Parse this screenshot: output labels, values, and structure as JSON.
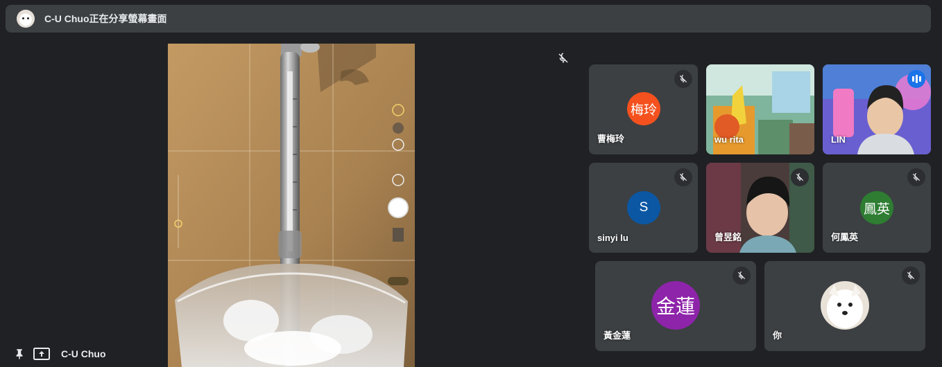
{
  "banner": {
    "text": "C-U Chuo正在分享螢幕畫面"
  },
  "presenter": {
    "name": "C-U Chuo"
  },
  "participants": [
    {
      "name": "曹梅玲",
      "initials": "梅玲",
      "avatar_color": "#f4511e",
      "muted": true
    },
    {
      "name": "wu rita",
      "video": true,
      "muted": false
    },
    {
      "name": "LIN",
      "video": true,
      "speaking": true
    },
    {
      "name": "sinyi lu",
      "initials": "S",
      "avatar_color": "#0b57a4",
      "muted": true
    },
    {
      "name": "曾昱銘",
      "video": true,
      "muted": true
    },
    {
      "name": "何鳳英",
      "initials": "鳳英",
      "avatar_color": "#2e7d32",
      "muted": true
    },
    {
      "name": "黃金蓮",
      "initials": "金蓮",
      "avatar_color": "#8e24aa",
      "muted": true
    },
    {
      "name": "你",
      "avatar": "puppy-photo",
      "muted": true
    }
  ],
  "colors": {
    "background": "#202124",
    "tile": "#3c4043",
    "active_border": "#8ab4f8",
    "speaking_badge": "#1a73e8"
  }
}
